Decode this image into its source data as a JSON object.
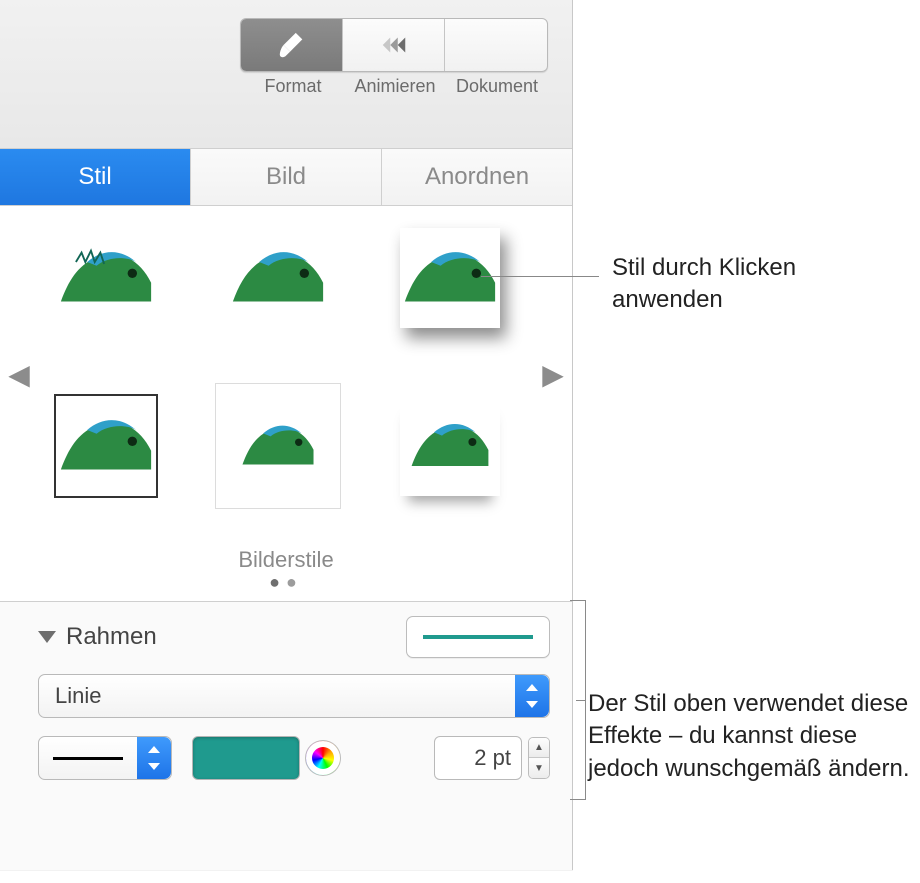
{
  "toolbar": {
    "format_label": "Format",
    "animate_label": "Animieren",
    "document_label": "Dokument"
  },
  "tabs": {
    "style": "Stil",
    "image": "Bild",
    "arrange": "Anordnen"
  },
  "styles": {
    "caption": "Bilderstile"
  },
  "border": {
    "section_title": "Rahmen",
    "type_value": "Linie",
    "size_value": "2 pt",
    "line_color": "#1f9a8e"
  },
  "callouts": {
    "apply_style": "Stil durch Klicken anwenden",
    "effects": "Der Stil oben verwendet diese Effekte – du kannst diese jedoch wunschgemäß ändern."
  }
}
